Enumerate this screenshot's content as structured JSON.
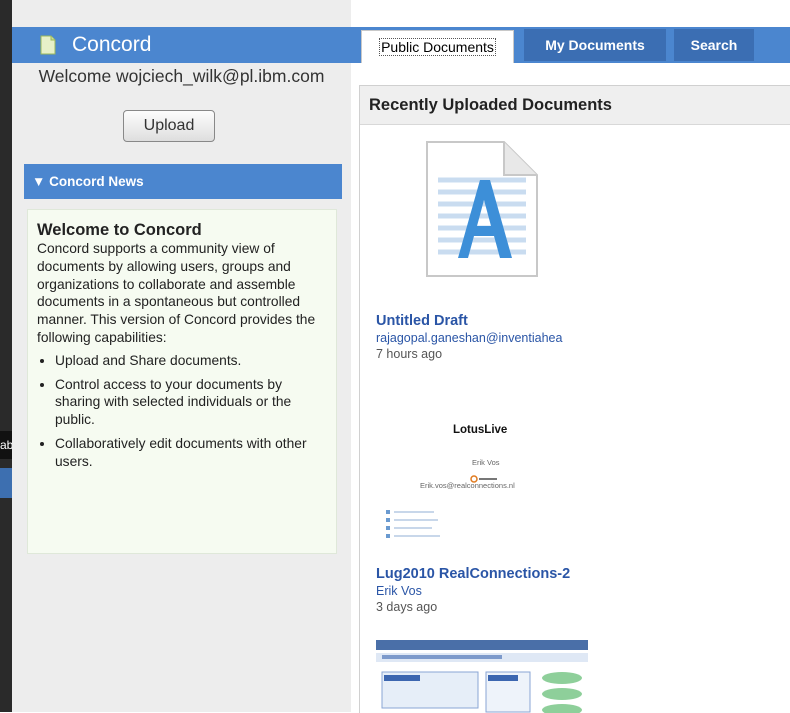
{
  "brand": {
    "title": "Concord",
    "icon": "document-icon"
  },
  "welcome_text": "Welcome wojciech_wilk@pl.ibm.com",
  "upload_label": "Upload",
  "news": {
    "header": "▼ Concord News",
    "title": "Welcome to Concord",
    "intro": "Concord supports a community view of documents by allowing users, groups and organizations to collaborate and assemble documents in a spontaneous but controlled manner. This version of Concord provides the following capabilities:",
    "bullets": [
      "Upload and Share documents.",
      "Control access to your documents by sharing with selected individuals or the public.",
      "Collaboratively edit documents with other users."
    ]
  },
  "tooltip_fragment": "ab",
  "tabs": [
    {
      "label": "Public Documents",
      "active": true
    },
    {
      "label": "My Documents",
      "active": false
    },
    {
      "label": "Search",
      "active": false
    }
  ],
  "panel_title": "Recently Uploaded Documents",
  "documents": [
    {
      "title": "Untitled Draft",
      "author": "rajagopal.ganeshan@inventiahea",
      "time": "7 hours ago",
      "thumbnail": "text-document-icon"
    },
    {
      "title": "Lug2010 RealConnections-2",
      "author": "Erik Vos",
      "time": "3 days ago",
      "thumbnail": "presentation-thumbnail"
    }
  ],
  "slide_preview": {
    "heading": "LotusLive",
    "name": "Erik Vos",
    "email": "Erik.vos@realconnections.nl"
  },
  "colors": {
    "brand_blue": "#4b86cf",
    "tab_blue": "#3b6eb3",
    "link_blue": "#2a55a6",
    "news_bg": "#f6fbf1"
  }
}
